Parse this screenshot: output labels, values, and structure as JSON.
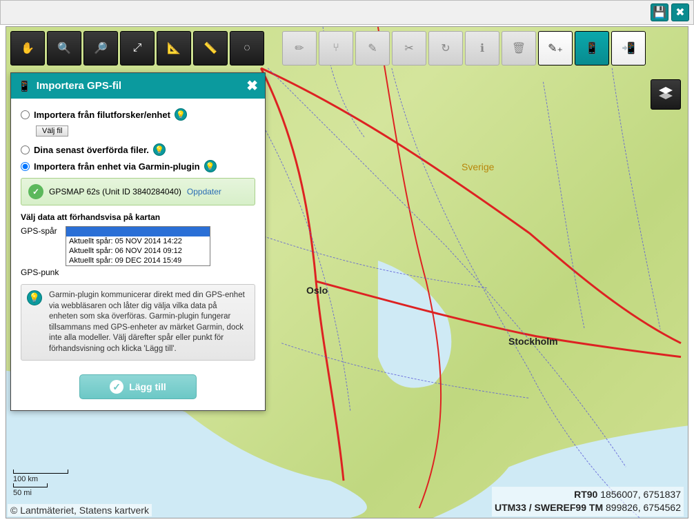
{
  "topbar": {
    "save_icon": "save-icon",
    "close_icon": "close-icon"
  },
  "toolbar_left": [
    {
      "name": "pan-tool",
      "icon": "✋"
    },
    {
      "name": "zoom-in-tool",
      "icon": "🔍+"
    },
    {
      "name": "zoom-out-tool",
      "icon": "🔍−"
    },
    {
      "name": "zoom-extent-tool",
      "icon": "⤢"
    },
    {
      "name": "measure-angle-tool",
      "icon": "📐"
    },
    {
      "name": "measure-distance-tool",
      "icon": "📏"
    },
    {
      "name": "selection-tool",
      "icon": "◌"
    }
  ],
  "toolbar_right": [
    {
      "name": "draw-tool",
      "icon": "✏",
      "disabled": true
    },
    {
      "name": "split-tool",
      "icon": "⑂",
      "disabled": true
    },
    {
      "name": "edit-tool",
      "icon": "✎",
      "disabled": true
    },
    {
      "name": "cut-tool",
      "icon": "✂",
      "disabled": true
    },
    {
      "name": "redo-tool",
      "icon": "↻",
      "disabled": true
    },
    {
      "name": "info-tool",
      "icon": "ℹ",
      "disabled": true
    },
    {
      "name": "delete-tool",
      "icon": "🗑",
      "disabled": true
    },
    {
      "name": "add-note-tool",
      "icon": "✎+",
      "style": "white"
    },
    {
      "name": "export-device-tool",
      "icon": "📱→",
      "style": "teal"
    },
    {
      "name": "import-device-tool",
      "icon": "→📱",
      "style": "white"
    }
  ],
  "layers_btn": {
    "icon": "≣"
  },
  "dialog": {
    "title": "Importera GPS-fil",
    "options": {
      "opt1_label": "Importera från filutforsker/enhet",
      "file_button": "Välj fil",
      "opt2_label": "Dina senast överförda filer.",
      "opt3_label": "Importera från enhet via Garmin-plugin"
    },
    "device": {
      "name": "GPSMAP 62s (Unit ID 3840284040)",
      "update_link": "Oppdater"
    },
    "preview_heading": "Välj data att förhandsvisa på kartan",
    "rows": {
      "tracks_label": "GPS-spår",
      "points_label": "GPS-punk"
    },
    "track_options": [
      {
        "label": "",
        "selected": true
      },
      {
        "label": "Aktuellt spår: 05 NOV 2014 14:22"
      },
      {
        "label": "Aktuellt spår: 06 NOV 2014 09:12"
      },
      {
        "label": "Aktuellt spår: 09 DEC 2014 15:49"
      }
    ],
    "info_text": "Garmin-plugin kommunicerar direkt med din GPS-enhet via webbläsaren och låter dig välja vilka data på enheten som ska överföras. Garmin-plugin fungerar tillsammans med GPS-enheter av märket Garmin, dock inte alla modeller.\nVälj därefter spår eller punkt för förhandsvisning och klicka 'Lägg till'.",
    "add_button": "Lägg till"
  },
  "map": {
    "labels": {
      "sverige": "Sverige",
      "oslo": "Oslo",
      "stockholm": "Stockholm"
    },
    "scale": {
      "km": "100 km",
      "mi": "50 mi"
    },
    "attribution": "© Lantmäteriet, Statens kartverk",
    "coords_line1_label": "RT90",
    "coords_line1_value": "1856007, 6751837",
    "coords_line2_label": "UTM33 / SWEREF99 TM",
    "coords_line2_value": "899826, 6754562"
  }
}
